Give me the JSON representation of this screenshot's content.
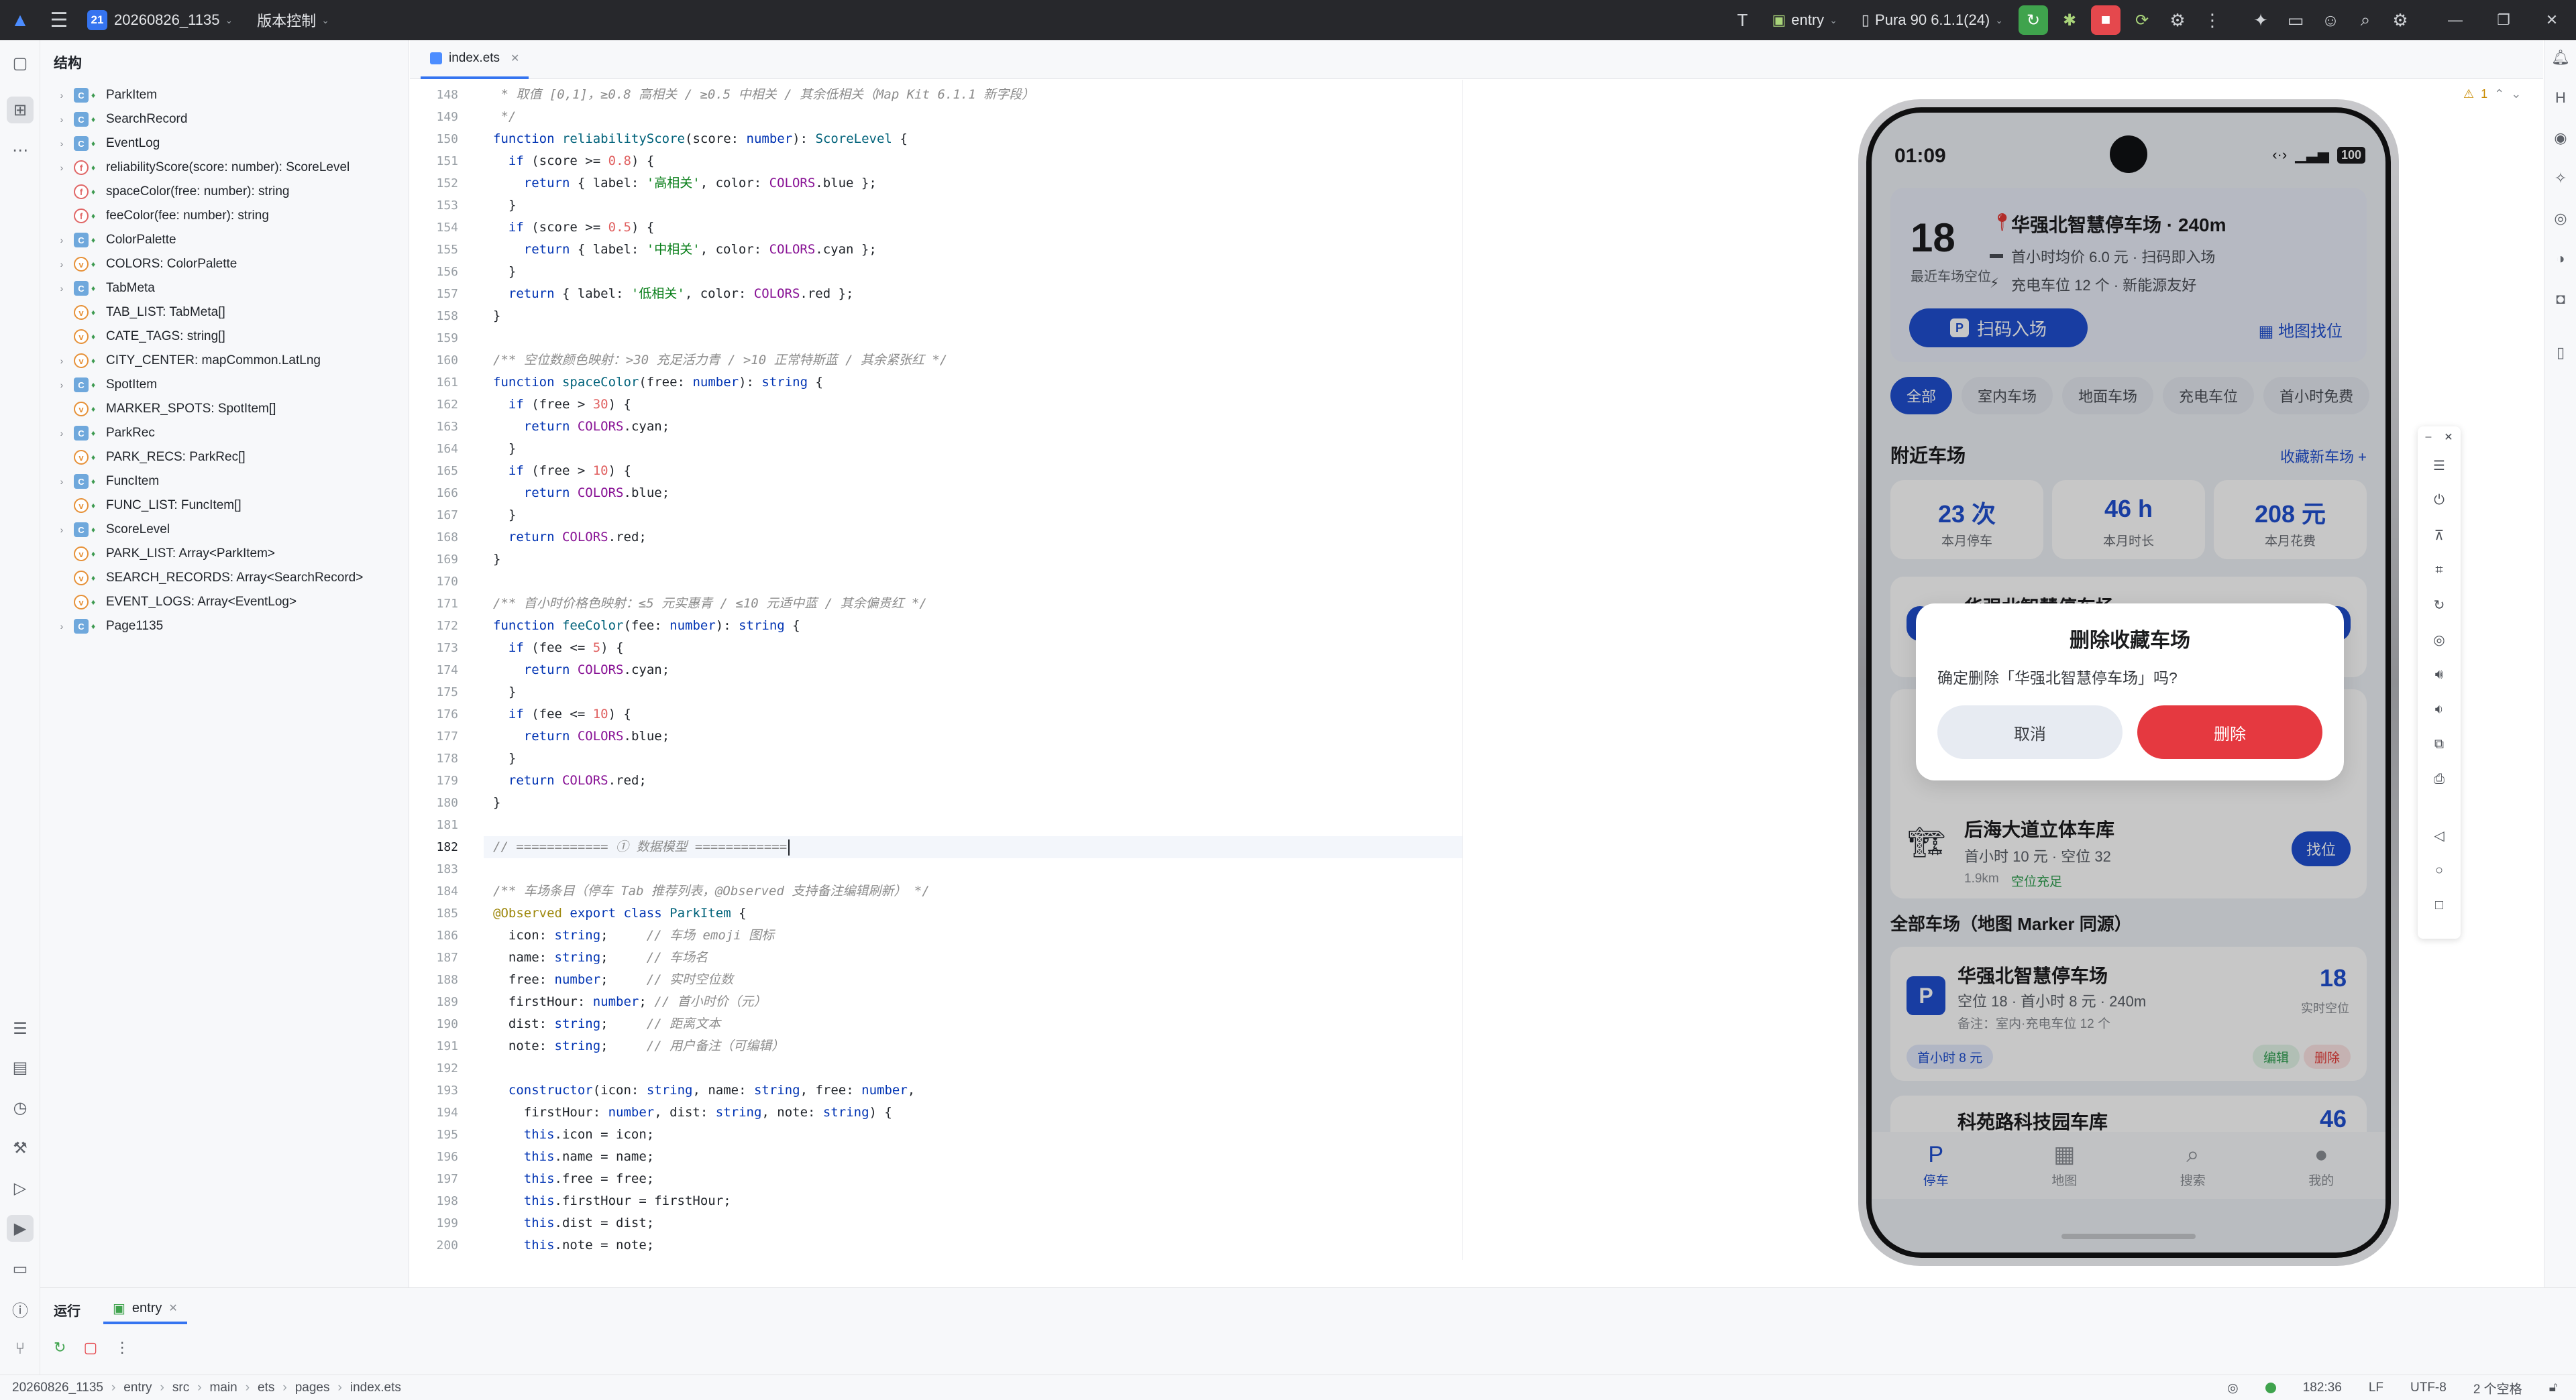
{
  "titlebar": {
    "project_badge": "21",
    "project_name": "20260826_1135",
    "vcs_label": "版本控制",
    "run_config": "entry",
    "device": "Pura 90 6.1.1(24)"
  },
  "structure": {
    "title": "结构",
    "items": [
      {
        "kind": "class",
        "expandable": true,
        "label": "ParkItem"
      },
      {
        "kind": "class",
        "expandable": true,
        "label": "SearchRecord"
      },
      {
        "kind": "class",
        "expandable": true,
        "label": "EventLog"
      },
      {
        "kind": "func",
        "expandable": true,
        "label": "reliabilityScore(score: number): ScoreLevel"
      },
      {
        "kind": "func",
        "expandable": false,
        "label": "spaceColor(free: number): string"
      },
      {
        "kind": "func",
        "expandable": false,
        "label": "feeColor(fee: number): string"
      },
      {
        "kind": "class",
        "expandable": true,
        "label": "ColorPalette"
      },
      {
        "kind": "var",
        "expandable": true,
        "label": "COLORS: ColorPalette"
      },
      {
        "kind": "class",
        "expandable": true,
        "label": "TabMeta"
      },
      {
        "kind": "var",
        "expandable": false,
        "label": "TAB_LIST: TabMeta[]"
      },
      {
        "kind": "var",
        "expandable": false,
        "label": "CATE_TAGS: string[]"
      },
      {
        "kind": "var",
        "expandable": true,
        "label": "CITY_CENTER: mapCommon.LatLng"
      },
      {
        "kind": "class",
        "expandable": true,
        "label": "SpotItem"
      },
      {
        "kind": "var",
        "expandable": false,
        "label": "MARKER_SPOTS: SpotItem[]"
      },
      {
        "kind": "class",
        "expandable": true,
        "label": "ParkRec"
      },
      {
        "kind": "var",
        "expandable": false,
        "label": "PARK_RECS: ParkRec[]"
      },
      {
        "kind": "class",
        "expandable": true,
        "label": "FuncItem"
      },
      {
        "kind": "var",
        "expandable": false,
        "label": "FUNC_LIST: FuncItem[]"
      },
      {
        "kind": "class",
        "expandable": true,
        "label": "ScoreLevel"
      },
      {
        "kind": "var",
        "expandable": false,
        "label": "PARK_LIST: Array<ParkItem>"
      },
      {
        "kind": "var",
        "expandable": false,
        "label": "SEARCH_RECORDS: Array<SearchRecord>"
      },
      {
        "kind": "var",
        "expandable": false,
        "label": "EVENT_LOGS: Array<EventLog>"
      },
      {
        "kind": "class",
        "expandable": true,
        "label": "Page1135"
      }
    ]
  },
  "editor": {
    "tab_name": "index.ets",
    "current_line": 182,
    "problems": "1",
    "lines": [
      {
        "n": 148,
        "html": "<span class=\"tok-cm\"> * 取值 [0,1]，≥0.8 高相关 / ≥0.5 中相关 / 其余低相关（Map Kit 6.1.1 新字段）</span>"
      },
      {
        "n": 149,
        "html": "<span class=\"tok-cm\"> */</span>"
      },
      {
        "n": 150,
        "html": "<span class=\"tok-kw\">function</span> <span class=\"tok-fn\">reliabilityScore</span>(score: <span class=\"tok-kw\">number</span>): <span class=\"tok-ty\">ScoreLevel</span> {"
      },
      {
        "n": 151,
        "html": "  <span class=\"tok-kw\">if</span> (score &gt;= <span class=\"tok-num\">0.8</span>) {"
      },
      {
        "n": 152,
        "html": "    <span class=\"tok-kw\">return</span> { label: <span class=\"tok-str\">'高相关'</span>, color: <span class=\"tok-pp\">COLORS</span>.blue };"
      },
      {
        "n": 153,
        "html": "  }"
      },
      {
        "n": 154,
        "html": "  <span class=\"tok-kw\">if</span> (score &gt;= <span class=\"tok-num\">0.5</span>) {"
      },
      {
        "n": 155,
        "html": "    <span class=\"tok-kw\">return</span> { label: <span class=\"tok-str\">'中相关'</span>, color: <span class=\"tok-pp\">COLORS</span>.cyan };"
      },
      {
        "n": 156,
        "html": "  }"
      },
      {
        "n": 157,
        "html": "  <span class=\"tok-kw\">return</span> { label: <span class=\"tok-str\">'低相关'</span>, color: <span class=\"tok-pp\">COLORS</span>.red };"
      },
      {
        "n": 158,
        "html": "}"
      },
      {
        "n": 159,
        "html": ""
      },
      {
        "n": 160,
        "html": "<span class=\"tok-cm\">/** 空位数颜色映射：&gt;30 充足活力青 / &gt;10 正常特斯蓝 / 其余紧张红 */</span>"
      },
      {
        "n": 161,
        "html": "<span class=\"tok-kw\">function</span> <span class=\"tok-fn\">spaceColor</span>(free: <span class=\"tok-kw\">number</span>): <span class=\"tok-kw\">string</span> {"
      },
      {
        "n": 162,
        "html": "  <span class=\"tok-kw\">if</span> (free &gt; <span class=\"tok-num\">30</span>) {"
      },
      {
        "n": 163,
        "html": "    <span class=\"tok-kw\">return</span> <span class=\"tok-pp\">COLORS</span>.cyan;"
      },
      {
        "n": 164,
        "html": "  }"
      },
      {
        "n": 165,
        "html": "  <span class=\"tok-kw\">if</span> (free &gt; <span class=\"tok-num\">10</span>) {"
      },
      {
        "n": 166,
        "html": "    <span class=\"tok-kw\">return</span> <span class=\"tok-pp\">COLORS</span>.blue;"
      },
      {
        "n": 167,
        "html": "  }"
      },
      {
        "n": 168,
        "html": "  <span class=\"tok-kw\">return</span> <span class=\"tok-pp\">COLORS</span>.red;"
      },
      {
        "n": 169,
        "html": "}"
      },
      {
        "n": 170,
        "html": ""
      },
      {
        "n": 171,
        "html": "<span class=\"tok-cm\">/** 首小时价格色映射：≤5 元实惠青 / ≤10 元适中蓝 / 其余偏贵红 */</span>"
      },
      {
        "n": 172,
        "html": "<span class=\"tok-kw\">function</span> <span class=\"tok-fn\">feeColor</span>(fee: <span class=\"tok-kw\">number</span>): <span class=\"tok-kw\">string</span> {"
      },
      {
        "n": 173,
        "html": "  <span class=\"tok-kw\">if</span> (fee &lt;= <span class=\"tok-num\">5</span>) {"
      },
      {
        "n": 174,
        "html": "    <span class=\"tok-kw\">return</span> <span class=\"tok-pp\">COLORS</span>.cyan;"
      },
      {
        "n": 175,
        "html": "  }"
      },
      {
        "n": 176,
        "html": "  <span class=\"tok-kw\">if</span> (fee &lt;= <span class=\"tok-num\">10</span>) {"
      },
      {
        "n": 177,
        "html": "    <span class=\"tok-kw\">return</span> <span class=\"tok-pp\">COLORS</span>.blue;"
      },
      {
        "n": 178,
        "html": "  }"
      },
      {
        "n": 179,
        "html": "  <span class=\"tok-kw\">return</span> <span class=\"tok-pp\">COLORS</span>.red;"
      },
      {
        "n": 180,
        "html": "}"
      },
      {
        "n": 181,
        "html": ""
      },
      {
        "n": 182,
        "html": "<span class=\"tok-cm\">// ============ ① 数据模型 ============</span>"
      },
      {
        "n": 183,
        "html": ""
      },
      {
        "n": 184,
        "html": "<span class=\"tok-cm\">/** 车场条目（停车 Tab 推荐列表，@Observed 支持备注编辑刷新） */</span>"
      },
      {
        "n": 185,
        "html": "<span class=\"tok-dec\">@Observed</span> <span class=\"tok-kw\">export class</span> <span class=\"tok-ty\">ParkItem</span> {"
      },
      {
        "n": 186,
        "html": "  icon: <span class=\"tok-kw\">string</span>;     <span class=\"tok-cm\">// 车场 emoji 图标</span>"
      },
      {
        "n": 187,
        "html": "  name: <span class=\"tok-kw\">string</span>;     <span class=\"tok-cm\">// 车场名</span>"
      },
      {
        "n": 188,
        "html": "  free: <span class=\"tok-kw\">number</span>;     <span class=\"tok-cm\">// 实时空位数</span>"
      },
      {
        "n": 189,
        "html": "  firstHour: <span class=\"tok-kw\">number</span>; <span class=\"tok-cm\">// 首小时价（元）</span>"
      },
      {
        "n": 190,
        "html": "  dist: <span class=\"tok-kw\">string</span>;     <span class=\"tok-cm\">// 距离文本</span>"
      },
      {
        "n": 191,
        "html": "  note: <span class=\"tok-kw\">string</span>;     <span class=\"tok-cm\">// 用户备注（可编辑）</span>"
      },
      {
        "n": 192,
        "html": ""
      },
      {
        "n": 193,
        "html": "  <span class=\"tok-kw\">constructor</span>(icon: <span class=\"tok-kw\">string</span>, name: <span class=\"tok-kw\">string</span>, free: <span class=\"tok-kw\">number</span>,"
      },
      {
        "n": 194,
        "html": "    firstHour: <span class=\"tok-kw\">number</span>, dist: <span class=\"tok-kw\">string</span>, note: <span class=\"tok-kw\">string</span>) {"
      },
      {
        "n": 195,
        "html": "    <span class=\"tok-kw\">this</span>.icon = icon;"
      },
      {
        "n": 196,
        "html": "    <span class=\"tok-kw\">this</span>.name = name;"
      },
      {
        "n": 197,
        "html": "    <span class=\"tok-kw\">this</span>.free = free;"
      },
      {
        "n": 198,
        "html": "    <span class=\"tok-kw\">this</span>.firstHour = firstHour;"
      },
      {
        "n": 199,
        "html": "    <span class=\"tok-kw\">this</span>.dist = dist;"
      },
      {
        "n": 200,
        "html": "    <span class=\"tok-kw\">this</span>.note = note;"
      }
    ]
  },
  "phone": {
    "time": "01:09",
    "battery": "100",
    "hero": {
      "free_count": "18",
      "free_label": "最近车场空位",
      "title": "华强北智慧停车场 · 240m",
      "line1": "首小时均价 6.0 元 · 扫码即入场",
      "line2": "充电车位 12 个 · 新能源友好",
      "scan_label": "扫码入场",
      "map_label": "地图找位"
    },
    "chips": [
      "全部",
      "室内车场",
      "地面车场",
      "充电车位",
      "首小时免费"
    ],
    "nearby_title": "附近车场",
    "nearby_link": "收藏新车场 +",
    "stats": [
      {
        "value": "23 次",
        "label": "本月停车"
      },
      {
        "value": "46 h",
        "label": "本月时长"
      },
      {
        "value": "208 元",
        "label": "本月花费"
      }
    ],
    "lot_top_partial": "华强北智慧停车场",
    "lot_houhai": {
      "title": "后海大道立体车库",
      "sub": "首小时 10 元 · 空位 32",
      "dist": "1.9km",
      "tag": "空位充足",
      "btn": "找位"
    },
    "all_title": "全部车场（地图 Marker 同源）",
    "lot_hqb": {
      "badge": "P",
      "title": "华强北智慧停车场",
      "sub": "空位 18 · 首小时 8 元 · 240m",
      "note": "备注：室内·充电车位 12 个",
      "free": "18",
      "free_label": "实时空位",
      "price_pill": "首小时 8 元",
      "edit": "编辑",
      "delete": "删除"
    },
    "lot_kyl": {
      "title": "科苑路科技园车库",
      "free": "46"
    },
    "tabs": [
      {
        "icon": "P",
        "label": "停车"
      },
      {
        "icon": "▦",
        "label": "地图"
      },
      {
        "icon": "⌕",
        "label": "搜索"
      },
      {
        "icon": "●",
        "label": "我的"
      }
    ],
    "dialog": {
      "title": "删除收藏车场",
      "message": "确定删除「华强北智慧停车场」吗?",
      "cancel": "取消",
      "confirm": "删除"
    }
  },
  "run_panel": {
    "label": "运行",
    "tab": "entry"
  },
  "status": {
    "crumbs": [
      "20260826_1135",
      "entry",
      "src",
      "main",
      "ets",
      "pages",
      "index.ets"
    ],
    "position": "182:36",
    "line_sep": "LF",
    "encoding": "UTF-8",
    "indent": "2 个空格"
  }
}
